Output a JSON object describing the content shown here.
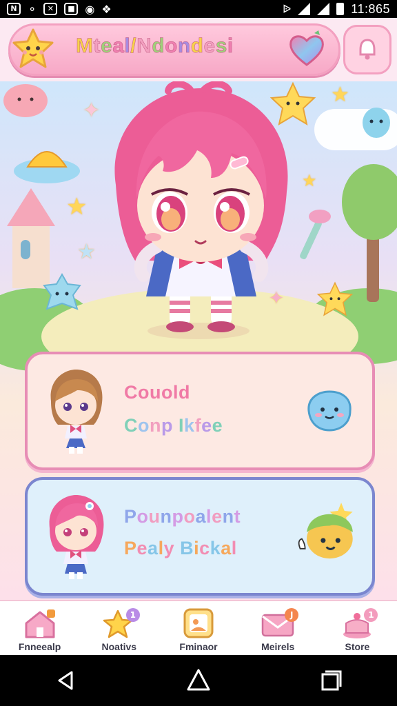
{
  "status_bar": {
    "time": "11:865",
    "left_icons": [
      "notification-icon",
      "headset-icon",
      "crossed-icon",
      "photo-icon",
      "camera-icon",
      "info-icon"
    ]
  },
  "header": {
    "title": "Mteal/Ndondesi",
    "title_colors": [
      "#f7d24a",
      "#f2a0c0",
      "#9fd07a",
      "#ef7fb0",
      "#a88be0"
    ]
  },
  "cards": [
    {
      "line1": "Couold",
      "line2": "Conp Ikfee",
      "line2_colors": [
        "#7fd0b8",
        "#9ec4ee",
        "#f2a0c0",
        "#b99ae8"
      ]
    },
    {
      "line1": "Pounpoalent",
      "line2": "Pealy Bickal",
      "line1_colors": [
        "#8fa6ea",
        "#d49be4",
        "#f19dc0"
      ],
      "line2_colors": [
        "#f6a85c",
        "#f28db2",
        "#86c6e8"
      ]
    }
  ],
  "bottom_nav": [
    {
      "label": "Fnneealp",
      "icon": "home-icon",
      "badge": "",
      "badge_color": "#f29b3d"
    },
    {
      "label": "Noativs",
      "icon": "star-icon",
      "badge": "1",
      "badge_color": "#b98be6"
    },
    {
      "label": "Fminaor",
      "icon": "photo-frame-icon",
      "badge": "",
      "badge_color": ""
    },
    {
      "label": "Meirels",
      "icon": "mail-icon",
      "badge": "J",
      "badge_color": "#f4864e"
    },
    {
      "label": "Store",
      "icon": "cake-icon",
      "badge": "1",
      "badge_color": "#f39cbd"
    }
  ],
  "colors": {
    "accent_pink": "#f3a0c0",
    "card1_border": "#e78db5",
    "card2_border": "#7b86cf"
  }
}
